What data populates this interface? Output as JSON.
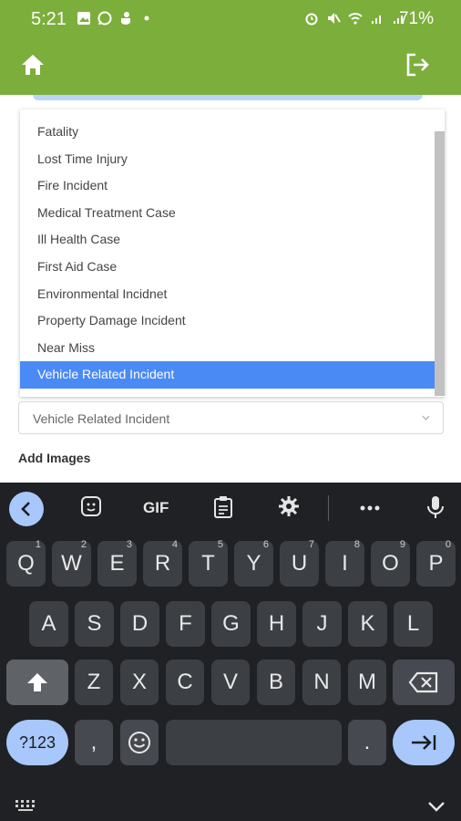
{
  "status_bar": {
    "time": "5:21",
    "battery": "71%"
  },
  "app_bar": {
    "home_icon": "home-icon",
    "logout_icon": "logout-icon"
  },
  "dropdown": {
    "options": [
      "Fatality",
      "Lost Time Injury",
      "Fire Incident",
      "Medical Treatment Case",
      "Ill Health Case",
      "First Aid Case",
      "Environmental Incidnet",
      "Property Damage Incident",
      "Near Miss",
      "Vehicle Related Incident"
    ],
    "selected_index": 9
  },
  "form": {
    "incident_type_value": "Vehicle Related Incident",
    "add_images_label": "Add Images"
  },
  "keyboard": {
    "toolbar": {
      "gif_label": "GIF"
    },
    "row1": [
      {
        "k": "Q",
        "h": "1"
      },
      {
        "k": "W",
        "h": "2"
      },
      {
        "k": "E",
        "h": "3"
      },
      {
        "k": "R",
        "h": "4"
      },
      {
        "k": "T",
        "h": "5"
      },
      {
        "k": "Y",
        "h": "6"
      },
      {
        "k": "U",
        "h": "7"
      },
      {
        "k": "I",
        "h": "8"
      },
      {
        "k": "O",
        "h": "9"
      },
      {
        "k": "P",
        "h": "0"
      }
    ],
    "row2": [
      "A",
      "S",
      "D",
      "F",
      "G",
      "H",
      "J",
      "K",
      "L"
    ],
    "row3": [
      "Z",
      "X",
      "C",
      "V",
      "B",
      "N",
      "M"
    ],
    "symbols_label": "?123",
    "comma_label": ",",
    "period_label": "."
  },
  "colors": {
    "app_bar": "#7cae3c",
    "selected_option": "#4a8af4",
    "keyboard_bg": "#1f2125",
    "key_accent": "#a8c7fa"
  }
}
